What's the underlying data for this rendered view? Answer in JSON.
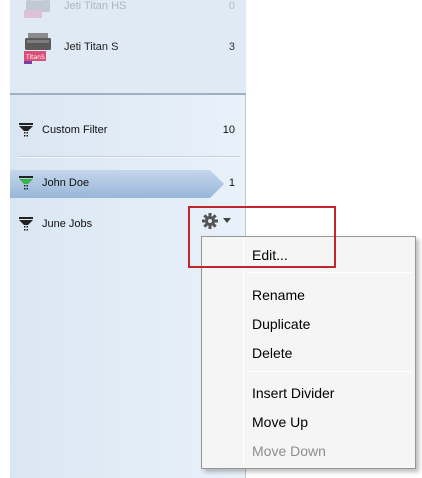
{
  "printers": [
    {
      "name": "Jeti Titan HS",
      "count": "0",
      "badge": "",
      "faded": true
    },
    {
      "name": "Jeti Titan S",
      "count": "3",
      "badge": "TitanS",
      "faded": false
    }
  ],
  "filters": [
    {
      "name": "Custom Filter",
      "count": "10",
      "selected": false,
      "icon_color": "#222222"
    },
    {
      "name": "John Doe",
      "count": "1",
      "selected": true,
      "icon_color": "#37b24d"
    },
    {
      "name": "June Jobs",
      "count": "",
      "selected": false,
      "icon_color": "#222222"
    }
  ],
  "context_menu": {
    "items": [
      {
        "label": "Edit...",
        "enabled": true
      },
      {
        "label": "Rename",
        "enabled": true
      },
      {
        "label": "Duplicate",
        "enabled": true
      },
      {
        "label": "Delete",
        "enabled": true
      },
      {
        "label": "Insert Divider",
        "enabled": true
      },
      {
        "label": "Move Up",
        "enabled": true
      },
      {
        "label": "Move Down",
        "enabled": false
      }
    ]
  },
  "colors": {
    "highlight_box": "#c0262d",
    "selected_row": "#a9c3e0",
    "sidebar_bg": "#dfeaf5",
    "badge_pink": "#d94f7a"
  },
  "icons": {
    "gear": "gear-icon",
    "dropdown": "chevron-down-icon",
    "filter": "funnel-icon",
    "printer": "printer-icon"
  }
}
